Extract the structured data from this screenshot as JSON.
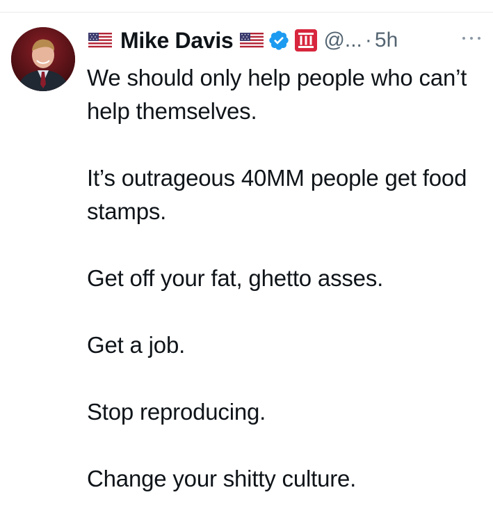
{
  "author": {
    "display_name": "Mike Davis",
    "handle": "@...",
    "separator": "·",
    "time": "5h",
    "verified": true,
    "icons": [
      "us-flag-icon",
      "us-flag-icon",
      "verified-badge-icon",
      "affiliate-badge-icon"
    ]
  },
  "colors": {
    "text": "#0f1419",
    "secondary": "#536471",
    "verified_blue": "#1d9bf0",
    "affiliate_red": "#d7263d"
  },
  "tweet": {
    "paragraphs": [
      "We should only help people who can’t help themselves.",
      "It’s outrageous 40MM people get food stamps.",
      "Get off your fat, ghetto asses.",
      "Get a job.",
      "Stop reproducing.",
      "Change your shitty culture."
    ]
  }
}
